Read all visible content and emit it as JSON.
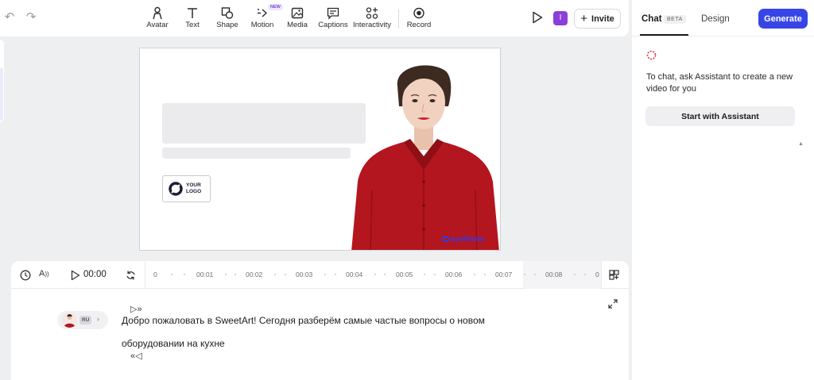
{
  "toolbar": {
    "tools": [
      {
        "label": "Avatar",
        "icon": "avatar-icon"
      },
      {
        "label": "Text",
        "icon": "text-icon"
      },
      {
        "label": "Shape",
        "icon": "shape-icon"
      },
      {
        "label": "Motion",
        "icon": "motion-icon",
        "badge": "NEW"
      },
      {
        "label": "Media",
        "icon": "media-icon"
      },
      {
        "label": "Captions",
        "icon": "captions-icon"
      },
      {
        "label": "Interactivity",
        "icon": "interactivity-icon"
      },
      {
        "label": "Record",
        "icon": "record-icon"
      }
    ],
    "user_initial": "I",
    "invite_label": "Invite"
  },
  "canvas": {
    "logo_text_line1": "YOUR",
    "logo_text_line2": "LOGO",
    "watermark": "synthesia"
  },
  "timeline": {
    "current_time": "00:00",
    "aa_label": "A",
    "ruler": [
      "0",
      "00:01",
      "00:02",
      "00:03",
      "00:04",
      "00:05",
      "00:06",
      "00:07",
      "00:08",
      "0"
    ]
  },
  "script": {
    "voice_lang": "RU",
    "line1": "Добро пожаловать в SweetArt! Сегодня разберём самые частые вопросы о новом",
    "line2": "оборудовании на кухне"
  },
  "right_panel": {
    "tab_chat": "Chat",
    "tab_chat_badge": "BETA",
    "tab_design": "Design",
    "generate_label": "Generate",
    "message": "To chat, ask Assistant to create a new video for you",
    "assistant_button": "Start with Assistant"
  },
  "colors": {
    "accent": "#3845e6",
    "user_chip": "#8b3fd8",
    "new_badge": "#7b46e0"
  }
}
